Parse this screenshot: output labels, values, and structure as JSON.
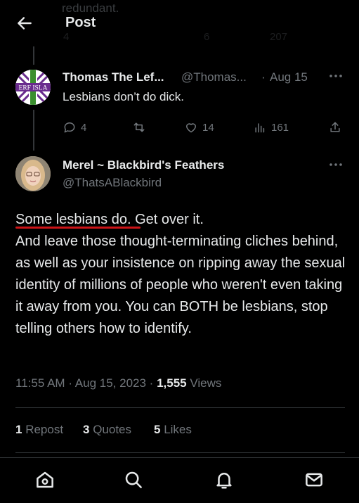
{
  "header": {
    "title": "Post",
    "ghost_text": "redundant.",
    "ghost_counts": {
      "replies": "4",
      "likes": "6",
      "views": "207"
    }
  },
  "parent_tweet": {
    "avatar_text": "ERF ISLA",
    "name": "Thomas The Lef...",
    "handle": "@Thomas...",
    "separator": "·",
    "date": "Aug 15",
    "text": "Lesbians don’t do dick.",
    "replies": "4",
    "reposts": "",
    "likes": "14",
    "views": "161"
  },
  "main_tweet": {
    "name": "Merel ~ Blackbird's Feathers",
    "handle": "@ThatsABlackbird",
    "line1": "Some lesbians do. Get over it.",
    "line2": "And leave those thought-terminating cliches behind, as well as your insistence on ripping away the sexual identity of millions of people who weren't even taking it away from you. You can BOTH be lesbians, stop telling others how to identify.",
    "time": "11:55 AM",
    "date": "Aug 15, 2023",
    "separator": "·",
    "views_count": "1,555",
    "views_label": "Views",
    "repost_count": "1",
    "repost_label": "Repost",
    "quote_count": "3",
    "quote_label": "Quotes",
    "like_count": "5",
    "like_label": "Likes"
  },
  "nav": [
    "home-icon",
    "search-icon",
    "notifications-icon",
    "messages-icon"
  ],
  "colors": {
    "background": "#000000",
    "text": "#e7e9ea",
    "muted": "#71767b",
    "underline": "#cc1417",
    "divider": "#2f3336"
  }
}
